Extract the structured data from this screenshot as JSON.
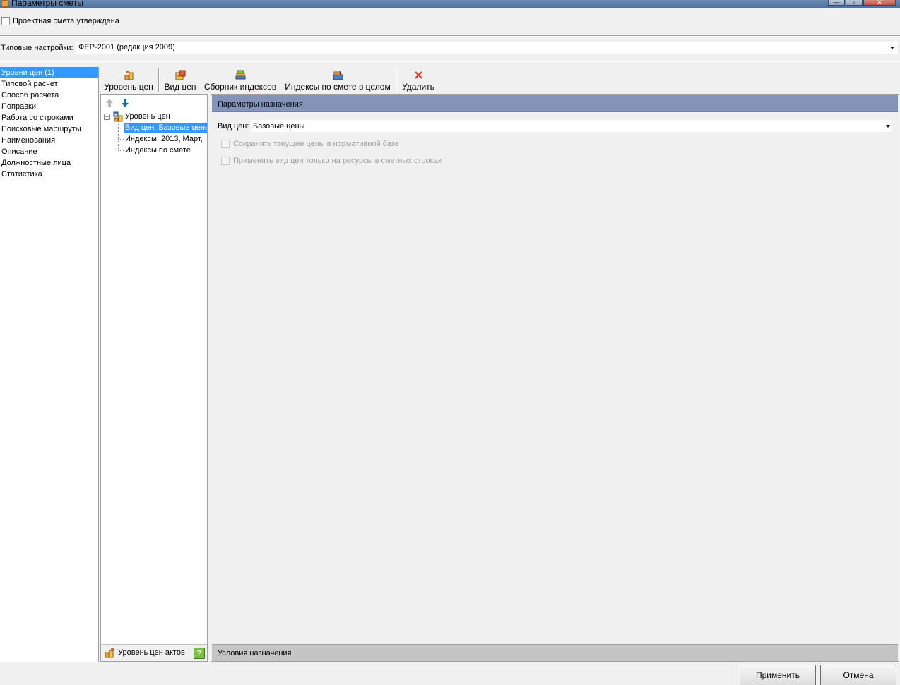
{
  "window": {
    "title": "Параметры сметы",
    "min_glyph": "—",
    "max_glyph": "▫",
    "close_glyph": "✕"
  },
  "approved_label": "Проектная смета утверждена",
  "settings": {
    "label": "Типовые настройки:",
    "value": "ФЕР-2001 (редакция 2009)"
  },
  "nav": {
    "items": [
      "Уровни цен (1)",
      "Типовой расчет",
      "Способ расчета",
      "Поправки",
      "Работа со строками",
      "Поисковые маршруты",
      "Наименования",
      "Описание",
      "Должностные лица",
      "Статистика"
    ]
  },
  "toolbar": {
    "level": "Уровень цен",
    "price_type": "Вид цен",
    "index_collection": "Сборник индексов",
    "estimate_indices": "Индексы по смете в целом",
    "delete": "Удалить"
  },
  "tree": {
    "root": "Уровень цен",
    "child_price": "Вид цен: Базовые цены",
    "child_indices": "Индексы: 2013, Март,",
    "child_estimate": "Индексы по смете",
    "footer": "Уровень цен актов",
    "help": "?"
  },
  "params": {
    "header": "Параметры назначения",
    "price_label": "Вид цен:",
    "price_value": "Базовые цены",
    "opt_save": "Сохранять текущие цены в нормативной базе",
    "opt_apply": "Применять вид цен только на ресурсы в сметных строках",
    "conditions": "Условия назначения"
  },
  "buttons": {
    "apply": "Применить",
    "cancel": "Отмена"
  },
  "colors": {
    "selection": "#3399ff",
    "section_header": "#8494b8",
    "delete_icon": "#e0301e"
  }
}
